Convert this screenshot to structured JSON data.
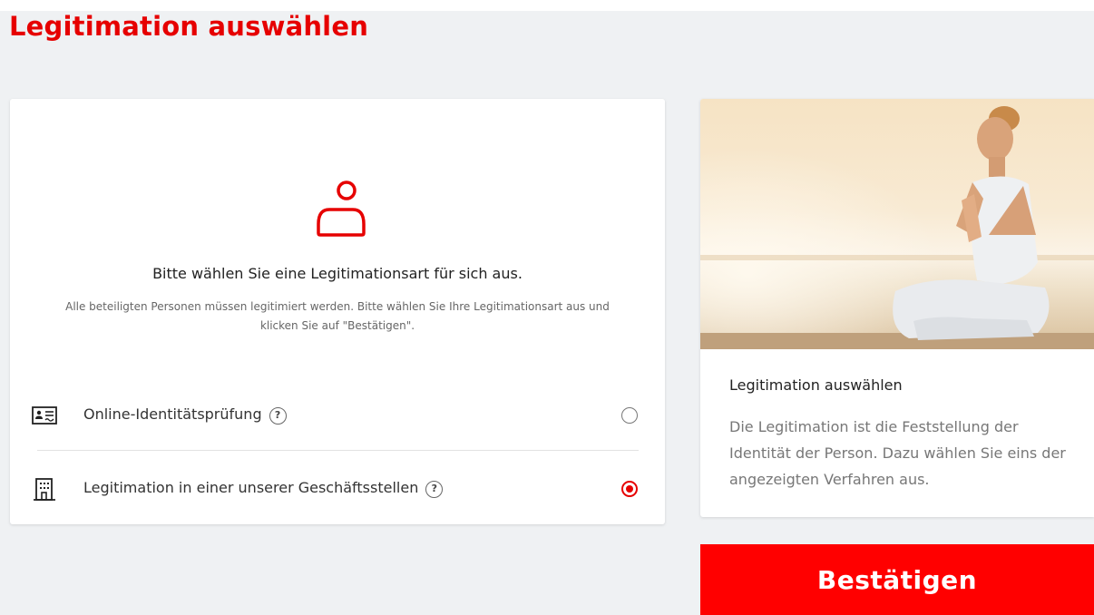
{
  "page": {
    "title": "Legitimation auswählen"
  },
  "selection": {
    "heading": "Bitte wählen Sie eine Legitimationsart für sich aus.",
    "description": "Alle beteiligten Personen müssen legitimiert werden. Bitte wählen Sie Ihre Legitimationsart aus und klicken Sie auf \"Bestätigen\".",
    "options": [
      {
        "label": "Online-Identitätsprüfung",
        "icon": "id-card-icon",
        "help": "?",
        "selected": false
      },
      {
        "label": "Legitimation in einer unserer Geschäftsstellen",
        "icon": "building-icon",
        "help": "?",
        "selected": true
      }
    ]
  },
  "info": {
    "image": "yoga-meditation-beach-photo",
    "title": "Legitimation auswählen",
    "text": "Die Legitimation ist die Feststellung der Identität der Person. Dazu wählen Sie eins der angezeigten Verfahren aus."
  },
  "actions": {
    "confirm_label": "Bestätigen"
  },
  "colors": {
    "accent": "#e60000",
    "button": "#ff0000",
    "background": "#eff1f3"
  }
}
